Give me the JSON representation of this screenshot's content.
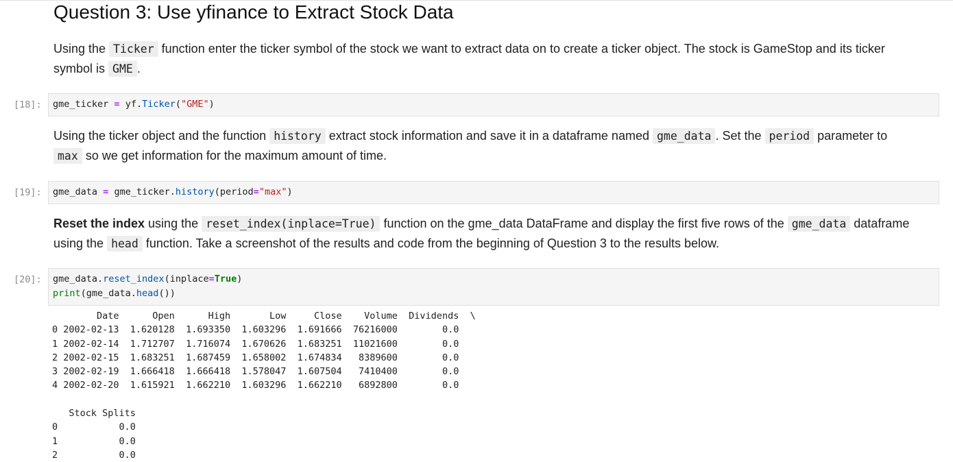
{
  "heading": "Question 3: Use yfinance to Extract Stock Data",
  "para1": {
    "t1": "Using the ",
    "c1": "Ticker",
    "t2": " function enter the ticker symbol of the stock we want to extract data on to create a ticker object. The stock is GameStop and its ticker symbol is ",
    "c2": "GME",
    "t3": "."
  },
  "cell18": {
    "prompt": "[18]:",
    "var": "gme_ticker",
    "op": "=",
    "obj": "yf.",
    "func": "Ticker",
    "open": "(",
    "str": "\"GME\"",
    "close": ")"
  },
  "para2": {
    "t1": "Using the ticker object and the function ",
    "c1": "history",
    "t2": " extract stock information and save it in a dataframe named ",
    "c2": "gme_data",
    "t3": ". Set the ",
    "c3": "period",
    "t4": " parameter to ",
    "c4": "max",
    "t5": " so we get information for the maximum amount of time."
  },
  "cell19": {
    "prompt": "[19]:",
    "var": "gme_data",
    "op": "=",
    "obj": "gme_ticker.",
    "func": "history",
    "open": "(period",
    "op2": "=",
    "str": "\"max\"",
    "close": ")"
  },
  "para3": {
    "b1": "Reset the index",
    "t1": " using the ",
    "c1": "reset_index(inplace=True)",
    "t2": " function on the gme_data DataFrame and display the first five rows of the ",
    "c2": "gme_data",
    "t3": " dataframe using the ",
    "c3": "head",
    "t4": " function. Take a screenshot of the results and code from the beginning of Question 3 to the results below."
  },
  "cell20": {
    "prompt": "[20]:",
    "l1_obj": "gme_data.",
    "l1_func": "reset_index",
    "l1_open": "(inplace",
    "l1_op": "=",
    "l1_kw": "True",
    "l1_close": ")",
    "l2_func": "print",
    "l2_open": "(gme_data.",
    "l2_meth": "head",
    "l2_close": "())"
  },
  "output": {
    "lines": [
      "        Date      Open      High       Low     Close    Volume  Dividends  \\",
      "0 2002-02-13  1.620128  1.693350  1.603296  1.691666  76216000        0.0   ",
      "1 2002-02-14  1.712707  1.716074  1.670626  1.683251  11021600        0.0   ",
      "2 2002-02-15  1.683251  1.687459  1.658002  1.674834   8389600        0.0   ",
      "3 2002-02-19  1.666418  1.666418  1.578047  1.607504   7410400        0.0   ",
      "4 2002-02-20  1.615921  1.662210  1.603296  1.662210   6892800        0.0   ",
      "",
      "   Stock Splits  ",
      "0           0.0  ",
      "1           0.0  ",
      "2           0.0  "
    ]
  }
}
